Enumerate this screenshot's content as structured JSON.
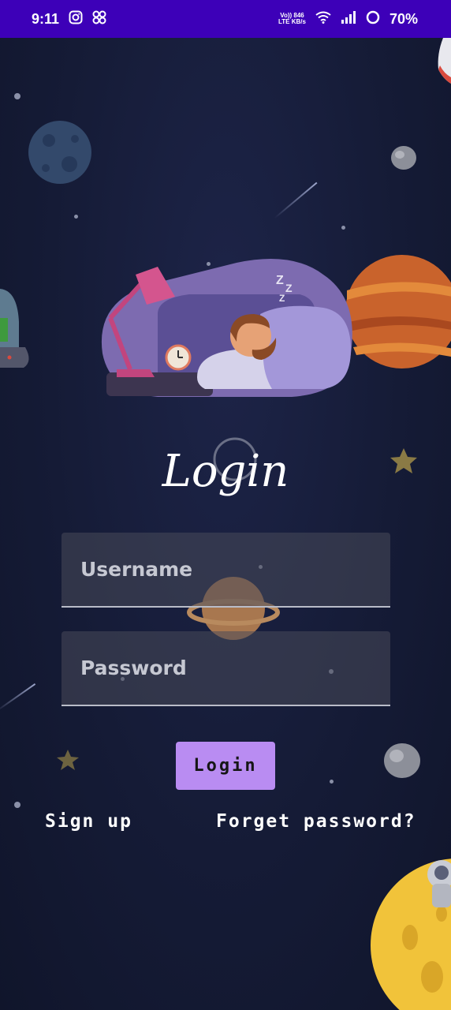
{
  "status_bar": {
    "time": "9:11",
    "net_top": "Vo)) 846",
    "net_bottom": "LTE KB/s",
    "battery": "70%",
    "icons": [
      "instagram-icon",
      "pinwheel-icon",
      "wifi-icon",
      "signal-icon",
      "battery-ring-icon"
    ]
  },
  "login": {
    "title": "Login",
    "username_placeholder": "Username",
    "password_placeholder": "Password",
    "button_label": "Login",
    "signup_label": "Sign up",
    "forgot_label": "Forget password?"
  },
  "colors": {
    "status_bar": "#3d00b8",
    "background": "#141a33",
    "button": "#b98cf2",
    "field": "#484a5a"
  }
}
